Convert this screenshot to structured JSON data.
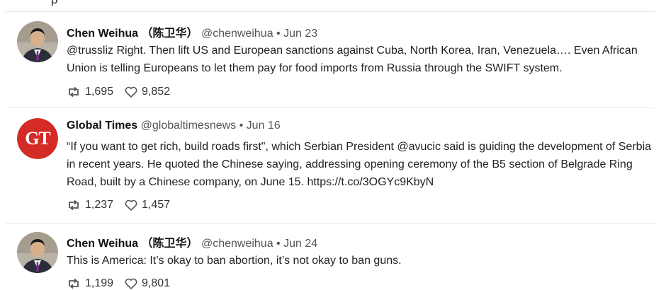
{
  "top_cut_text": "p",
  "tweets": [
    {
      "name": "Chen Weihua （陈卫华）",
      "handle": "@chenweihua",
      "date": "Jun 23",
      "text": "@trussliz Right. Then lift US and European sanctions against Cuba, North Korea, Iran, Venezuela…. Even African Union is telling Europeans to let them pay for food imports from Russia through the SWIFT system.",
      "retweets": "1,695",
      "likes": "9,852",
      "avatar": "portrait-photo"
    },
    {
      "name": "Global Times",
      "handle": "@globaltimesnews",
      "date": "Jun 16",
      "text": "“If you want to get rich, build roads first\", which Serbian President @avucic said is guiding the development of Serbia in recent years. He quoted the Chinese saying, addressing opening ceremony of the B5 section of Belgrade Ring Road, built by a Chinese company, on June 15. https://t.co/3OGYc9KbyN",
      "retweets": "1,237",
      "likes": "1,457",
      "avatar": "GT",
      "avatar_color": "#d52b27"
    },
    {
      "name": "Chen Weihua （陈卫华）",
      "handle": "@chenweihua",
      "date": "Jun 24",
      "text": "This is America: It’s okay to ban abortion, it’s not okay to ban guns.",
      "retweets": "1,199",
      "likes": "9,801",
      "avatar": "portrait-photo"
    }
  ],
  "separator": " • ",
  "icons": {
    "retweet": "retweet-icon",
    "like": "heart-icon"
  }
}
